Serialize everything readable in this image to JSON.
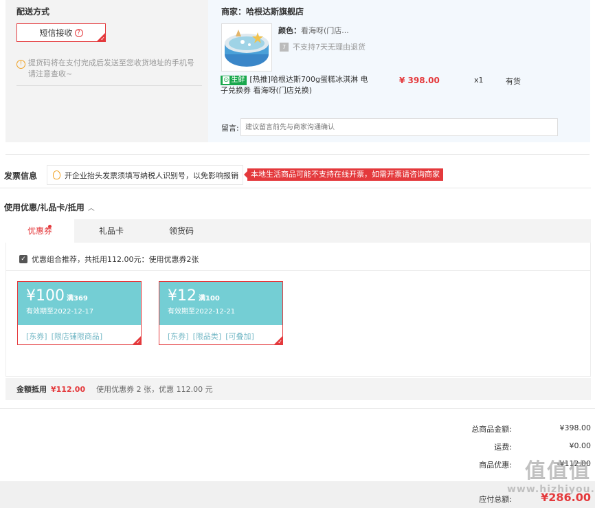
{
  "delivery": {
    "title": "配送方式",
    "sms_label": "短信接收",
    "tip_line1": "提货码将在支付完成后发送至您收货地址的手机号",
    "tip_line2": "请注意查收~"
  },
  "shop": {
    "label": "商家：",
    "name": "哈根达斯旗舰店",
    "color_label": "颜色：",
    "color_value": "看海呀(门店...",
    "no_return": "不支持7天无理由退货",
    "fresh_tag": "生鲜",
    "product_title_line1": "[热推]哈根达斯700g蛋糕冰淇淋 电",
    "product_title_line2": "子兑换券 看海呀(门店兑换)",
    "price": "¥ 398.00",
    "qty": "x1",
    "stock": "有货",
    "message_label": "留言:",
    "message_placeholder": "建议留言前先与商家沟通确认"
  },
  "invoice": {
    "title": "发票信息",
    "tip": "开企业抬头发票须填写纳税人识别号，以免影响报销",
    "alert": "本地生活商品可能不支持在线开票，如需开票请咨询商家"
  },
  "coupons": {
    "section_title": "使用优惠/礼品卡/抵用",
    "tabs": [
      "优惠券",
      "礼品卡",
      "领货码"
    ],
    "recommend": "优惠组合推荐，共抵用112.00元：使用优惠券2张",
    "items": [
      {
        "amount": "¥100",
        "condition": "满369",
        "expiry": "有效期至2022-12-17",
        "tags": [
          "[东券]",
          "[限店铺限商品]"
        ]
      },
      {
        "amount": "¥12",
        "condition": "满100",
        "expiry": "有效期至2022-12-21",
        "tags": [
          "[东券]",
          "[限品类]",
          "[可叠加]"
        ]
      }
    ],
    "summary_label": "金额抵用",
    "summary_amount": "¥112.00",
    "summary_text": "使用优惠券 2 张，优惠 112.00 元"
  },
  "totals": {
    "goods_label": "总商品金额:",
    "goods_value": "¥398.00",
    "shipping_label": "运费:",
    "shipping_value": "¥0.00",
    "discount_label": "商品优惠:",
    "discount_value": "-¥112.00",
    "payable_label": "应付总额:",
    "payable_value": "¥286.00"
  },
  "watermark": {
    "logo": "值",
    "text": "www.hizhiyou.com"
  },
  "colors": {
    "accent_red": "#e4393c",
    "coupon_teal": "#74ced4",
    "fresh_green": "#19a84d"
  }
}
